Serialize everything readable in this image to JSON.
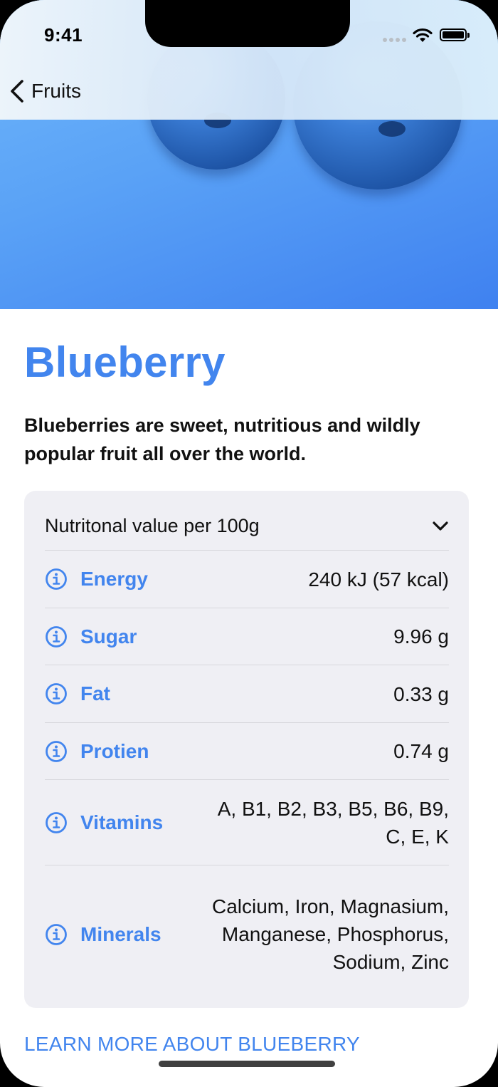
{
  "status_bar": {
    "time": "9:41"
  },
  "nav": {
    "back_label": "Fruits"
  },
  "fruit": {
    "title": "Blueberry",
    "headline": "Blueberries are sweet, nutritious and wildly popular fruit all over the world."
  },
  "nutrition": {
    "header": "Nutritonal value per 100g",
    "rows": [
      {
        "label": "Energy",
        "value": "240 kJ (57 kcal)"
      },
      {
        "label": "Sugar",
        "value": "9.96 g"
      },
      {
        "label": "Fat",
        "value": "0.33 g"
      },
      {
        "label": "Protien",
        "value": "0.74 g"
      },
      {
        "label": "Vitamins",
        "value": "A, B1, B2, B3, B5, B6, B9, C, E, K"
      },
      {
        "label": "Minerals",
        "value": "Calcium, Iron, Magnasium, Manganese, Phosphorus, Sodium, Zinc"
      }
    ]
  },
  "link": {
    "label": "LEARN MORE ABOUT BLUEBERRY"
  },
  "colors": {
    "accent": "#4285ee",
    "hero_gradient_start": "#6fb7fb",
    "hero_gradient_end": "#3f81f0",
    "card_background": "#efeff4"
  },
  "icons": {
    "back": "chevron-left-icon",
    "expand": "chevron-down-icon",
    "row": "info-circle-icon",
    "wifi": "wifi-icon",
    "signal": "cellular-signal-icon",
    "battery": "battery-icon"
  }
}
